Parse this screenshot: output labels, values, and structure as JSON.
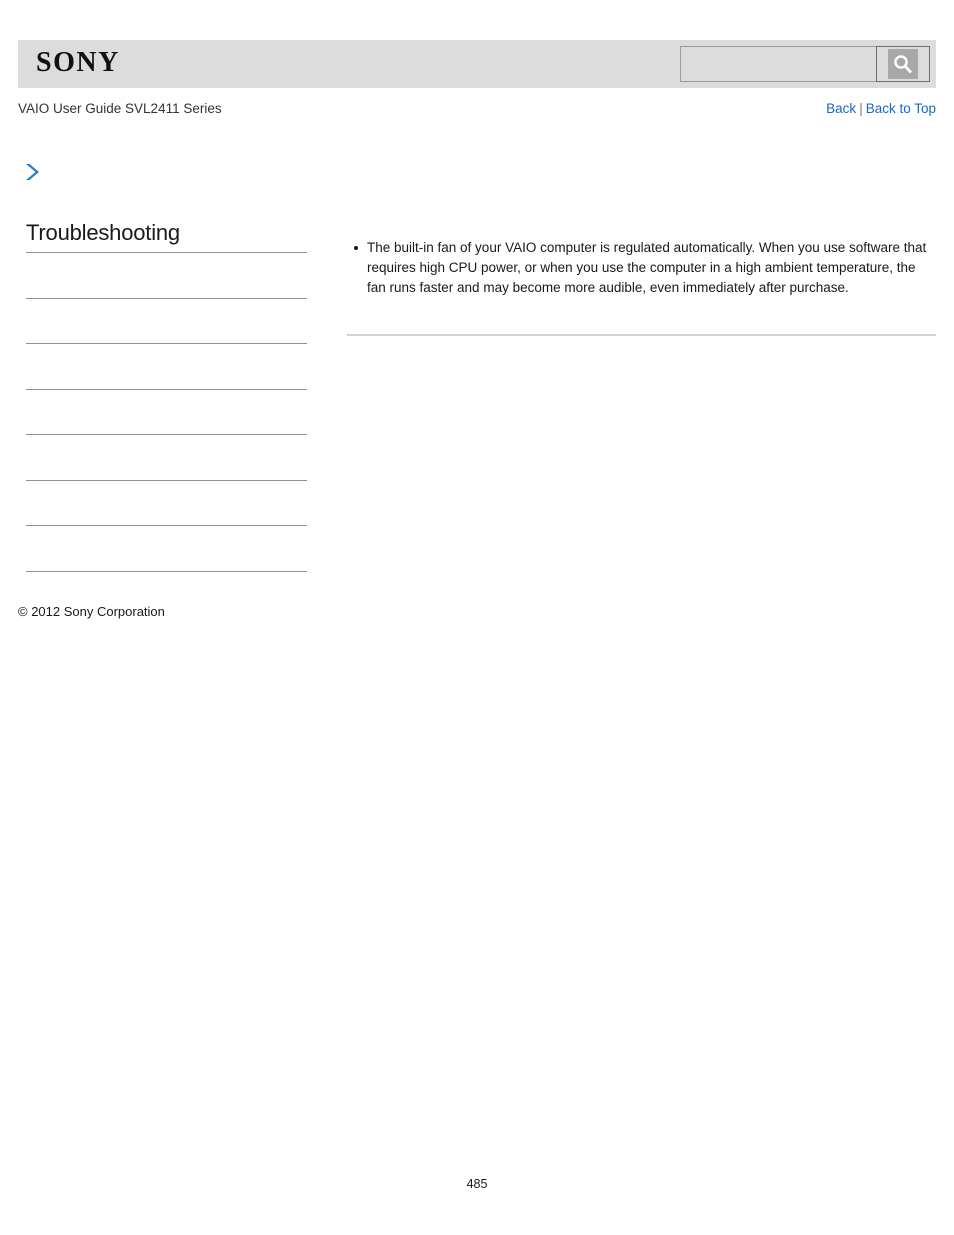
{
  "header": {
    "logo_text": "SONY",
    "search": {
      "value": "",
      "placeholder": "",
      "icon": "search-icon",
      "button_label": ""
    }
  },
  "title_row": {
    "guide_title": "VAIO User Guide SVL2411 Series",
    "back_label": "Back",
    "separator": "|",
    "back_to_top_label": "Back to Top"
  },
  "breadcrumb_icon": "chevron-right-icon",
  "sidebar": {
    "heading": "Troubleshooting",
    "items": [
      {
        "label": ""
      },
      {
        "label": ""
      },
      {
        "label": ""
      },
      {
        "label": ""
      },
      {
        "label": ""
      },
      {
        "label": ""
      },
      {
        "label": ""
      }
    ]
  },
  "copyright": "© 2012 Sony Corporation",
  "main": {
    "bullets": [
      "The built-in fan of your VAIO computer is regulated automatically. When you use software that requires high CPU power, or when you use the computer in a high ambient temperature, the fan runs faster and may become more audible, even immediately after purchase."
    ]
  },
  "footer": {
    "page_number": "485"
  },
  "colors": {
    "header_bg": "#dcdcdc",
    "link": "#1569c7",
    "chevron": "#2183c4",
    "rule": "#909090",
    "content_rule": "#d2d2d2"
  }
}
